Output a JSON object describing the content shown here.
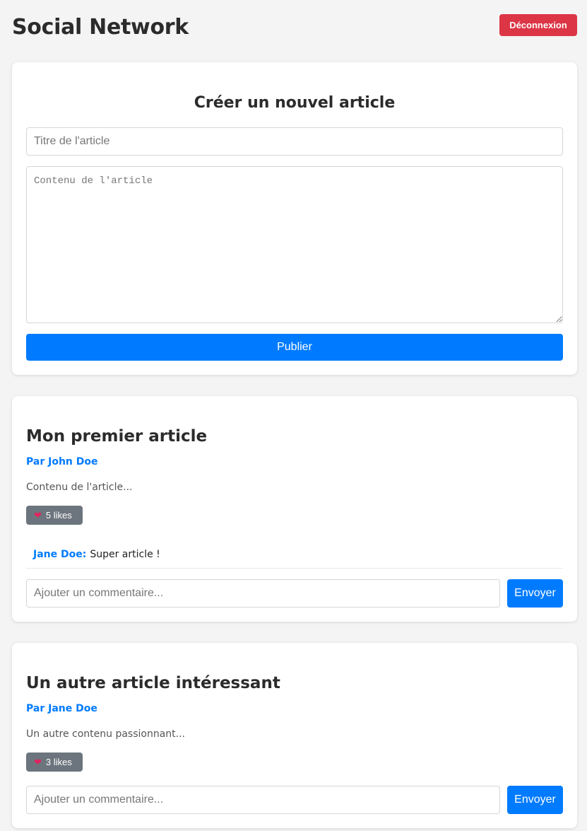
{
  "header": {
    "app_title": "Social Network",
    "logout_label": "Déconnexion"
  },
  "create_form": {
    "heading": "Créer un nouvel article",
    "title_placeholder": "Titre de l'article",
    "title_value": "",
    "content_placeholder": "Contenu de l'article",
    "content_value": "",
    "publish_label": "Publier"
  },
  "articles": [
    {
      "title": "Mon premier article",
      "author": "Par John Doe",
      "content": "Contenu de l'article...",
      "likes_label": "5 likes",
      "likes": 5,
      "comments": [
        {
          "author": "Jane Doe:",
          "text": "Super article !"
        }
      ],
      "comment_placeholder": "Ajouter un commentaire...",
      "send_label": "Envoyer"
    },
    {
      "title": "Un autre article intéressant",
      "author": "Par Jane Doe",
      "content": "Un autre contenu passionnant...",
      "likes_label": "3 likes",
      "likes": 3,
      "comments": [],
      "comment_placeholder": "Ajouter un commentaire...",
      "send_label": "Envoyer"
    }
  ],
  "icons": {
    "like": "heart-icon"
  },
  "colors": {
    "primary": "#007bff",
    "danger": "#dc3545",
    "secondary": "#6c757d",
    "heart": "#e0245e",
    "background": "#f4f4f4"
  }
}
